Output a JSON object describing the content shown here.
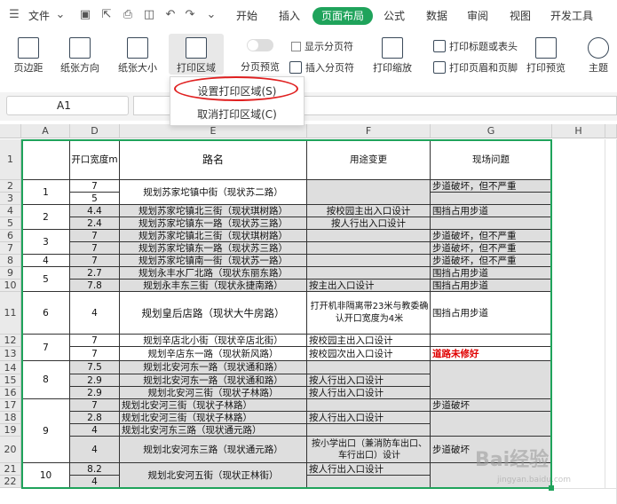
{
  "menubar": {
    "file": "文件",
    "tabs": [
      "开始",
      "插入",
      "页面布局",
      "公式",
      "数据",
      "审阅",
      "视图",
      "开发工具"
    ],
    "active_tab": "页面布局"
  },
  "ribbon": {
    "margins": "页边距",
    "orientation": "纸张方向",
    "size": "纸张大小",
    "print_area": "打印区域",
    "page_break_preview": "分页预览",
    "show_page_breaks": "显示分页符",
    "insert_page_break": "插入分页符",
    "print_scale": "打印缩放",
    "print_titles": "打印标题或表头",
    "header_footer": "打印页眉和页脚",
    "print_preview": "打印预览",
    "theme": "主题"
  },
  "dropdown": {
    "set_print_area": "设置打印区域(S)",
    "clear_print_area": "取消打印区域(C)"
  },
  "namebox": {
    "value": "A1"
  },
  "columns": [
    "A",
    "D",
    "E",
    "F",
    "G",
    "H"
  ],
  "header_row": {
    "d": "开口宽度m",
    "e": "路名",
    "f": "用途变更",
    "g": "现场问题"
  },
  "rows": [
    "1",
    "2",
    "3",
    "4",
    "5",
    "6",
    "7",
    "8",
    "9",
    "10",
    "11",
    "12",
    "13",
    "14",
    "15",
    "16",
    "17",
    "18",
    "19",
    "20",
    "21",
    "22"
  ],
  "groups": [
    {
      "num": "1",
      "d": [
        "7",
        "5"
      ],
      "e": "规划苏家坨镇中街（现状苏二路）",
      "f": "",
      "g": "步道破坏，但不严重"
    },
    {
      "num": "2",
      "d": [
        "4.4",
        "2.4"
      ],
      "e1": "规划苏家坨镇北三街（现状琪树路）",
      "e2": "规划苏家坨镇东一路（现状苏三路）",
      "f1": "按校园主出入口设计",
      "f2": "按人行出入口设计",
      "g": "围挡占用步道"
    },
    {
      "num": "3",
      "d": [
        "7",
        "7"
      ],
      "e1": "规划苏家坨镇北三街（现状琪树路）",
      "e2": "规划苏家坨镇东一路（现状苏三路）",
      "g1": "步道破坏，但不严重",
      "g2": "步道破坏，但不严重"
    },
    {
      "num": "4",
      "d": "7",
      "e": "规划苏家坨镇南一街（现状苏一路）",
      "g": "步道破坏，但不严重"
    },
    {
      "num": "5",
      "d": [
        "2.7",
        "7.8"
      ],
      "e1": "规划永丰水厂北路（现状东丽东路）",
      "e2": "规划永丰东三街（现状永捷南路）",
      "f2": "按主出入口设计",
      "g1": "围挡占用步道",
      "g2": "围挡占用步道"
    },
    {
      "num": "6",
      "d": "4",
      "e": "规划皇后店路（现状大牛房路）",
      "f": "打开机非隔离带23米与教委确认开口宽度为4米",
      "g": "围挡占用步道"
    },
    {
      "num": "7",
      "d": [
        "7",
        "7"
      ],
      "e1": "规划辛店北小街（现状辛店北街）",
      "e2": "规划辛店东一路（现状新风路）",
      "f1": "按校园主出入口设计",
      "f2": "按校园次出入口设计",
      "g2": "道路未修好"
    },
    {
      "num": "8",
      "d": [
        "7.5",
        "2.9",
        "2.9"
      ],
      "e1": "规划北安河东一路（现状通和路）",
      "e2": "规划北安河东一路（现状通和路）",
      "e3": "规划北安河三街（现状子林路）",
      "f2": "按人行出入口设计",
      "f3": "按人行出入口设计"
    },
    {
      "num": "9",
      "d": [
        "7",
        "2.8",
        "4",
        "4"
      ],
      "e1": "规划北安河三街（现状子林路）",
      "e2": "规划北安河三街（现状子林路）",
      "e3": "规划北安河东三路（现状通元路）",
      "e4": "规划北安河东三路（现状通元路）",
      "f2": "按人行出入口设计",
      "f4": "按小学出口（兼消防车出口、车行出口）设计",
      "g1": "步道破坏",
      "g4": "步道破坏"
    },
    {
      "num": "10",
      "d": [
        "8.2",
        "4"
      ],
      "e": "规划北安河五街（现状正林街）",
      "f1": "按人行出入口设计"
    }
  ],
  "watermark": {
    "brand": "Bai经验",
    "url": "jingyan.baidu.com"
  }
}
